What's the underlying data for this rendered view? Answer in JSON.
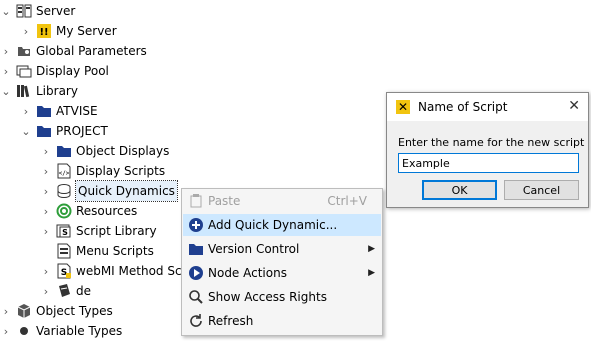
{
  "tree": {
    "server": "Server",
    "my_server": "My Server",
    "global_parameters": "Global Parameters",
    "display_pool": "Display Pool",
    "library": "Library",
    "atvise": "ATVISE",
    "project": "PROJECT",
    "object_displays": "Object Displays",
    "display_scripts": "Display Scripts",
    "quick_dynamics": "Quick Dynamics",
    "resources": "Resources",
    "script_library": "Script Library",
    "menu_scripts": "Menu Scripts",
    "webmi_method_scripts": "webMI Method Scr",
    "de": "de",
    "object_types": "Object Types",
    "variable_types": "Variable Types"
  },
  "context_menu": {
    "paste": "Paste",
    "paste_shortcut": "Ctrl+V",
    "add_quick_dynamic": "Add Quick Dynamic...",
    "version_control": "Version Control",
    "node_actions": "Node Actions",
    "show_access_rights": "Show Access Rights",
    "refresh": "Refresh"
  },
  "dialog": {
    "title": "Name of Script",
    "prompt": "Enter the name for the new script",
    "value": "Example",
    "ok": "OK",
    "cancel": "Cancel",
    "close_glyph": "✕"
  },
  "colors": {
    "folder": "#1f3f8f",
    "highlight": "#cde8ff",
    "accent": "#0078d7"
  }
}
